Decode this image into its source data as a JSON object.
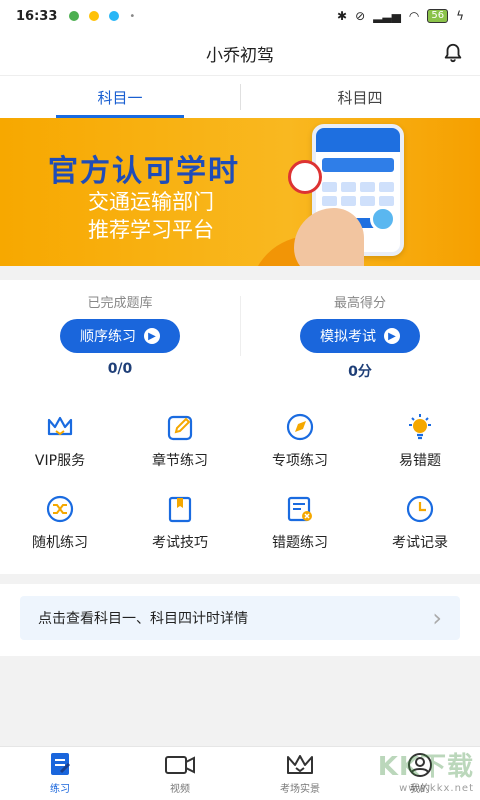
{
  "status_bar": {
    "time": "16:33",
    "battery": "56"
  },
  "header": {
    "title": "小乔初驾"
  },
  "tabs": [
    {
      "label": "科目一",
      "active": true
    },
    {
      "label": "科目四",
      "active": false
    }
  ],
  "banner": {
    "headline": "官方认可学时",
    "line1": "交通运输部门",
    "line2": "推荐学习平台"
  },
  "stats": {
    "left": {
      "label": "已完成题库",
      "button": "顺序练习",
      "value": "0/0"
    },
    "right": {
      "label": "最高得分",
      "button": "模拟考试",
      "value": "0分"
    }
  },
  "menu": [
    {
      "label": "VIP服务",
      "icon": "crown-icon"
    },
    {
      "label": "章节练习",
      "icon": "edit-icon"
    },
    {
      "label": "专项练习",
      "icon": "compass-icon"
    },
    {
      "label": "易错题",
      "icon": "bulb-icon"
    },
    {
      "label": "随机练习",
      "icon": "shuffle-icon"
    },
    {
      "label": "考试技巧",
      "icon": "bookmark-icon"
    },
    {
      "label": "错题练习",
      "icon": "wrong-list-icon"
    },
    {
      "label": "考试记录",
      "icon": "clock-icon"
    }
  ],
  "notice": {
    "text": "点击查看科目一、科目四计时详情"
  },
  "bottom_nav": [
    {
      "label": "练习",
      "active": true
    },
    {
      "label": "视频",
      "active": false
    },
    {
      "label": "考场实景",
      "active": false
    },
    {
      "label": "我的",
      "active": false
    }
  ],
  "watermark": {
    "text": "KK下载",
    "sub": "www.kkx.net"
  },
  "colors": {
    "primary": "#1a66dc",
    "banner": "#f7a800",
    "menu_icon": "#1a6be0",
    "menu_icon_accent": "#f5a800"
  }
}
